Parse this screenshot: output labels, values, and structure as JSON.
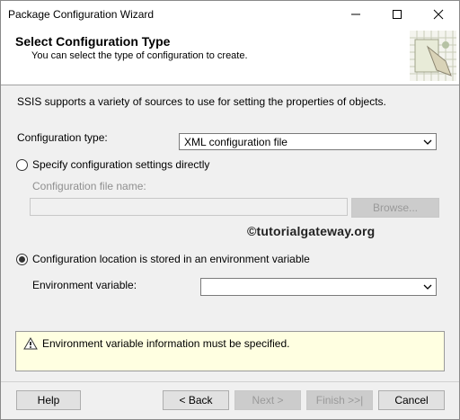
{
  "window": {
    "title": "Package Configuration Wizard"
  },
  "header": {
    "title": "Select Configuration Type",
    "subtitle": "You can select the type of configuration to create."
  },
  "body": {
    "intro": "SSIS supports a variety of sources to use for setting the properties of objects.",
    "config_type_label": "Configuration type:",
    "config_type_value": "XML configuration file",
    "radio_direct_label": "Specify configuration settings directly",
    "radio_direct_checked": false,
    "config_file_label": "Configuration file name:",
    "config_file_value": "",
    "browse_label": "Browse...",
    "watermark": "©tutorialgateway.org",
    "radio_env_label": "Configuration location is stored in an environment variable",
    "radio_env_checked": true,
    "env_var_label": "Environment variable:",
    "env_var_value": ""
  },
  "message": {
    "icon": "warning-icon",
    "text": "Environment variable information must be specified."
  },
  "footer": {
    "help_label": "Help",
    "back_label": "< Back",
    "next_label": "Next >",
    "finish_label": "Finish >>|",
    "cancel_label": "Cancel"
  },
  "colors": {
    "window_bg": "#f0f0f0",
    "header_bg": "#ffffff",
    "message_bg": "#ffffe1"
  }
}
